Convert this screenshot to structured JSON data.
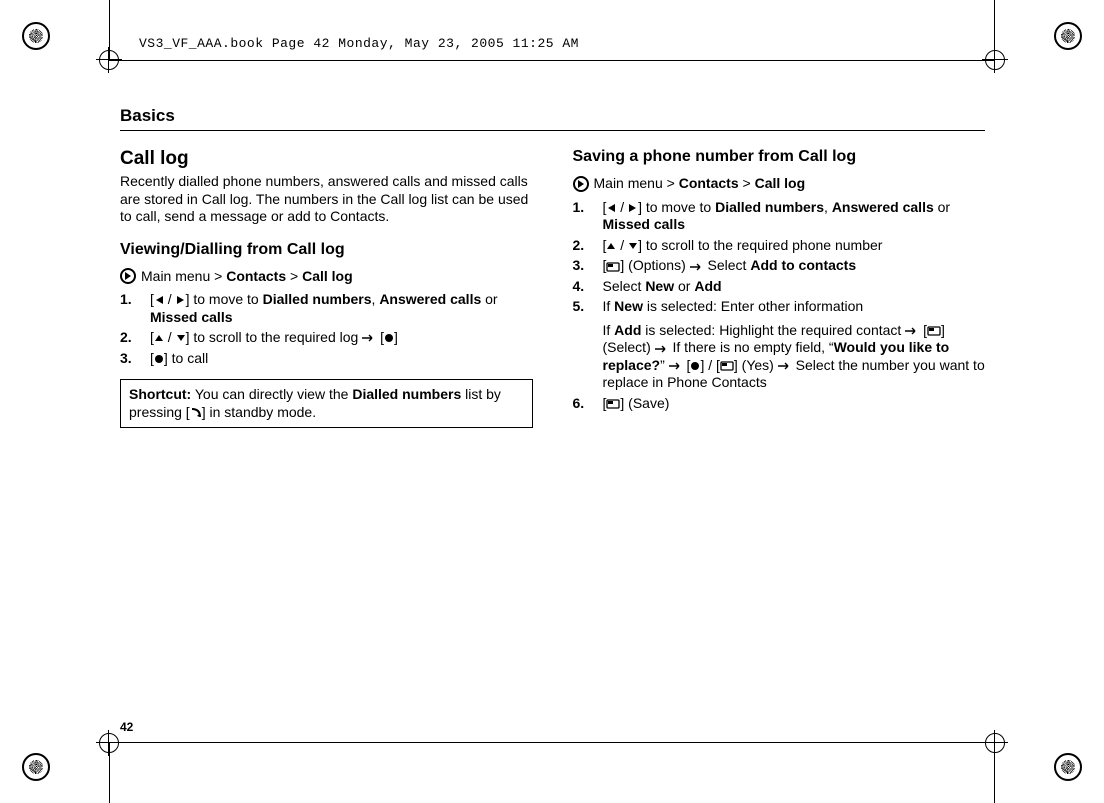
{
  "running_header": "VS3_VF_AAA.book  Page 42  Monday, May 23, 2005  11:25 AM",
  "page_number": "42",
  "section_header": "Basics",
  "left": {
    "h2": "Call log",
    "intro": "Recently dialled phone numbers, answered calls and missed calls are stored in Call log. The numbers in the Call log list can be used to call, send a message or add to Contacts.",
    "sub1": "Viewing/Dialling from Call log",
    "nav": {
      "pre": "Main menu > ",
      "b1": "Contacts",
      "mid": " > ",
      "b2": "Call log"
    },
    "s1": {
      "num": "1.",
      "a": "[",
      "b": "] to move to ",
      "c": "Dialled numbers",
      "d": ", ",
      "e": "Answered calls",
      "f": " or ",
      "g": "Missed calls"
    },
    "s2": {
      "num": "2.",
      "a": "[",
      "b": "] to scroll to the required log ",
      "c": " [",
      "d": "]"
    },
    "s3": {
      "num": "3.",
      "a": "[",
      "b": "] to call"
    },
    "box": {
      "lab": "Shortcut:",
      "a": "  You can directly view the ",
      "b": "Dialled numbers",
      "c": " list by pressing [",
      "d": "] in standby mode."
    }
  },
  "right": {
    "sub1": "Saving a phone number from Call log",
    "nav": {
      "pre": "Main menu > ",
      "b1": "Contacts",
      "mid": " > ",
      "b2": "Call log"
    },
    "s1": {
      "num": "1.",
      "a": "[",
      "b": "] to move to ",
      "c": "Dialled numbers",
      "d": ", ",
      "e": "Answered calls",
      "f": " or ",
      "g": "Missed calls"
    },
    "s2": {
      "num": "2.",
      "a": "[",
      "b": "] to scroll to the required phone number"
    },
    "s3": {
      "num": "3.",
      "a": "[",
      "b": "] (Options) ",
      "c": " Select ",
      "d": "Add to contacts"
    },
    "s4": {
      "num": "4.",
      "a": "Select ",
      "b": "New",
      "c": " or ",
      "d": "Add"
    },
    "s5": {
      "num": "5.",
      "a": "If ",
      "b": "New",
      "c": " is selected: Enter other information",
      "p2a": "If ",
      "p2b": "Add",
      "p2c": " is selected: Highlight the required contact ",
      "p2d": " [",
      "p2e": "] (Select) ",
      "p2f": " If there is no empty field, “",
      "p2g": "Would you like to replace?",
      "p2h": "” ",
      "p2i": " [",
      "p2j": "]",
      "p2k": " / ",
      "p2l": "[",
      "p2m": "] (Yes) ",
      "p2n": " Select the number you want to replace in Phone Contacts"
    },
    "s6": {
      "num": "6.",
      "a": "[",
      "b": "] (Save)"
    }
  }
}
